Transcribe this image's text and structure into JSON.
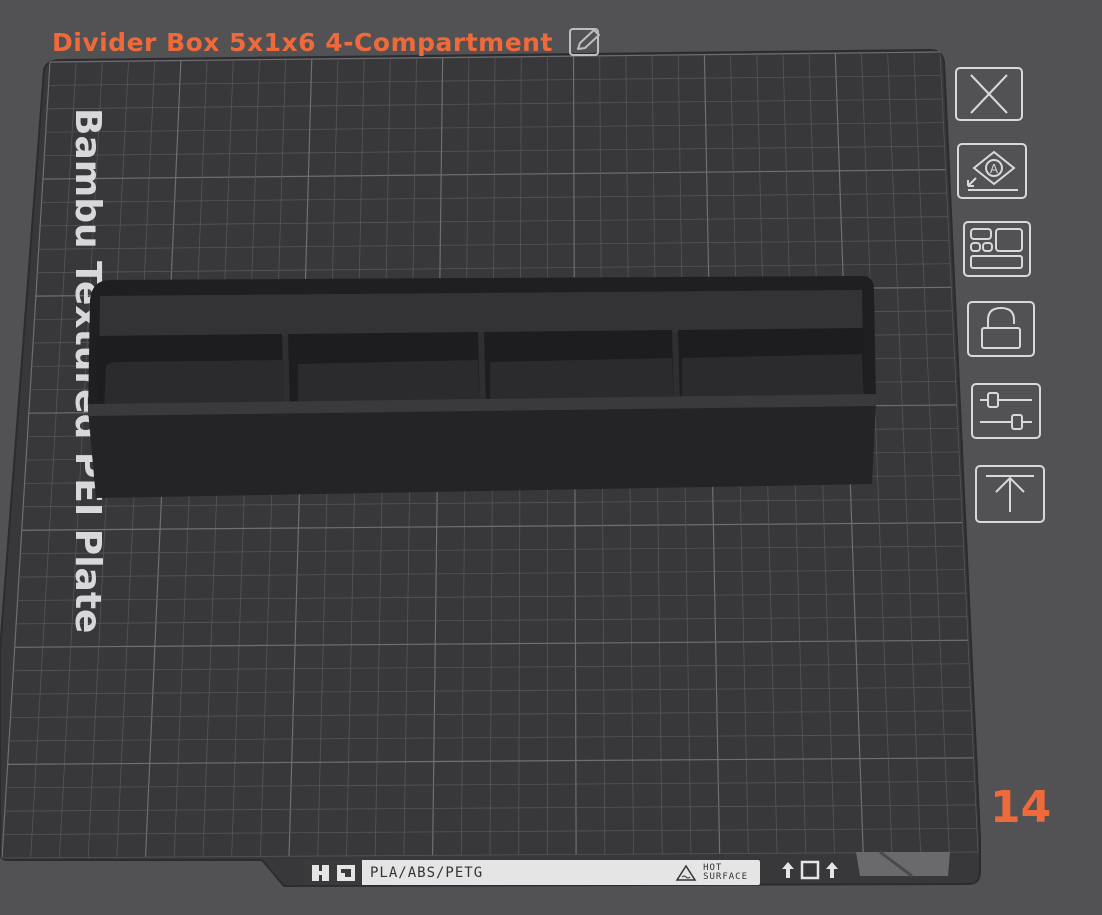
{
  "plate": {
    "name": "Divider Box 5x1x6 4-Compartment",
    "number": "14",
    "bed_label": "Bambu Textured PEI Plate"
  },
  "label_strip": {
    "materials": "PLA/ABS/PETG",
    "warning_line1": "HOT",
    "warning_line2": "SURFACE"
  },
  "toolbar": {
    "icons": [
      "close-icon",
      "auto-orient-icon",
      "arrange-icon",
      "lock-icon",
      "settings-sliders-icon",
      "move-to-top-icon"
    ]
  },
  "colors": {
    "accent": "#ee6a3a",
    "background": "#525255",
    "bed": "#38383b",
    "grid": "#5d5d61",
    "model": "#2a2a2c"
  }
}
